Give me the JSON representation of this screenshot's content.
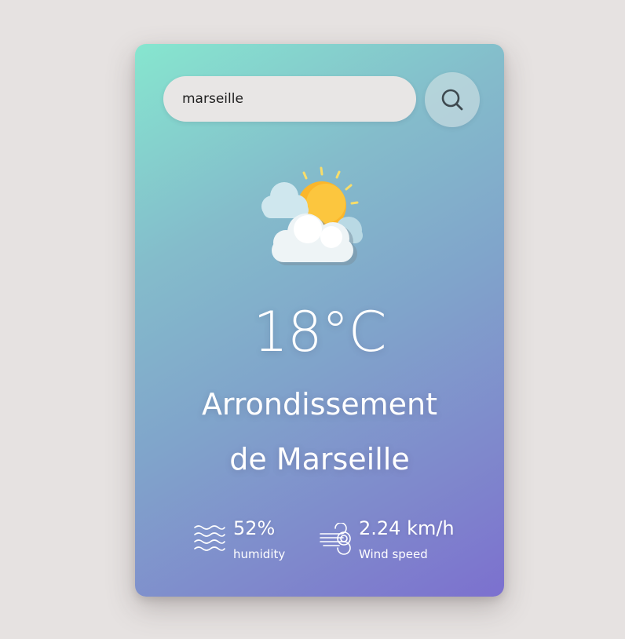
{
  "search": {
    "value": "marseille",
    "button_icon": "search-icon"
  },
  "weather": {
    "icon": "partly-cloudy-sun-icon",
    "temperature": "18°C",
    "city_line1": "Arrondissement",
    "city_line2": "de Marseille"
  },
  "details": {
    "humidity_value": "52%",
    "humidity_label": "humidity",
    "humidity_icon": "humidity-waves-icon",
    "wind_value": "2.24 km/h",
    "wind_label": "Wind speed",
    "wind_icon": "wind-icon"
  },
  "colors": {
    "background": "#e6e2e1",
    "card_gradient_start": "#86e6cf",
    "card_gradient_end": "#7c70cf",
    "input_background": "#e8e6e5",
    "sun": "#fbb62b",
    "text": "#ffffff"
  }
}
